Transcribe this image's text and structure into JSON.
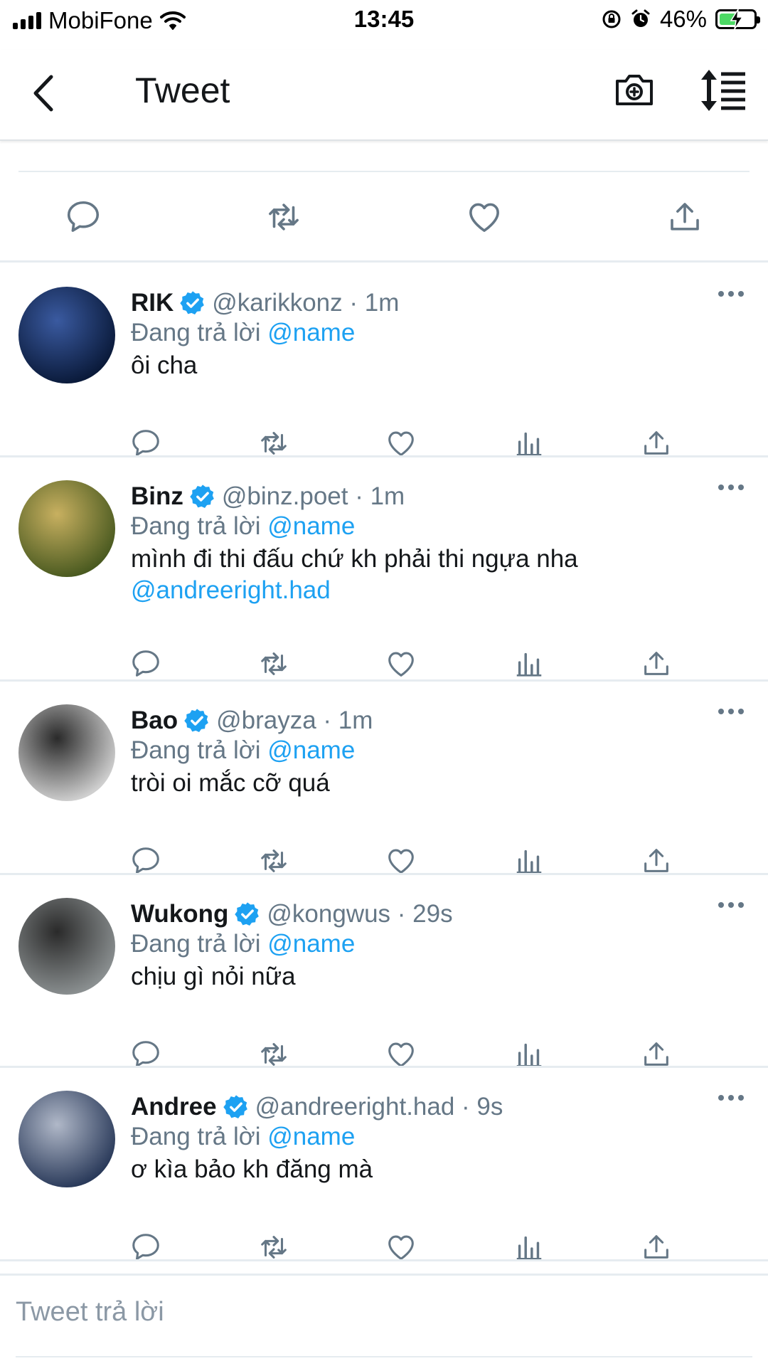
{
  "status_bar": {
    "carrier": "MobiFone",
    "time": "13:45",
    "battery": "46%"
  },
  "header": {
    "title": "Tweet"
  },
  "main_tweet_actions": [
    "reply-icon",
    "retweet-icon",
    "like-icon",
    "share-icon"
  ],
  "replies": [
    {
      "name": "RIK",
      "handle": "@karikkonz · 1m",
      "replying_prefix": "Đang trả lời",
      "replying_to": "@name",
      "text": "ôi cha",
      "mention": "",
      "avatar_colors": [
        "#0a1a3a",
        "#3a5aa0"
      ]
    },
    {
      "name": "Binz",
      "handle": "@binz.poet · 1m",
      "replying_prefix": "Đang trả lời",
      "replying_to": "@name",
      "text": "mình đi thi đấu chứ kh phải thi ngựa nha",
      "mention": "@andreeright.had",
      "avatar_colors": [
        "#4a5a20",
        "#c8b060"
      ]
    },
    {
      "name": "Bao",
      "handle": "@brayza · 1m",
      "replying_prefix": "Đang trả lời",
      "replying_to": "@name",
      "text": "tròi oi mắc cỡ quá",
      "mention": "",
      "avatar_colors": [
        "#cfcfcf",
        "#2a2a2a"
      ]
    },
    {
      "name": "Wukong",
      "handle": "@kongwus · 29s",
      "replying_prefix": "Đang trả lời",
      "replying_to": "@name",
      "text": "chịu gì nỏi nữa",
      "mention": "",
      "avatar_colors": [
        "#8a8f90",
        "#2a2a2a"
      ]
    },
    {
      "name": "Andree",
      "handle": "@andreeright.had · 9s",
      "replying_prefix": "Đang trả lời",
      "replying_to": "@name",
      "text": "ơ kìa bảo kh đăng mà",
      "mention": "",
      "avatar_colors": [
        "#2a3a5a",
        "#b0b8c8"
      ]
    }
  ],
  "composer": {
    "placeholder": "Tweet trả lời"
  },
  "colors": {
    "accent": "#1da1f2",
    "secondary_text": "#657786",
    "divider": "#e6ecf0",
    "icon": "#657786"
  }
}
